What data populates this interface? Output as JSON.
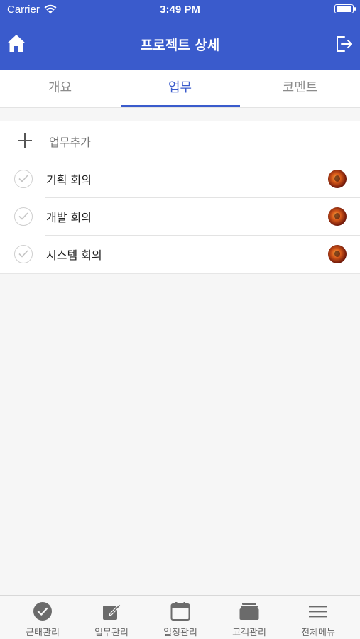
{
  "status_bar": {
    "carrier": "Carrier",
    "time": "3:49 PM",
    "battery_level": 1.0
  },
  "header": {
    "title": "프로젝트 상세",
    "left_icon": "home-icon",
    "right_icon": "logout-icon"
  },
  "tabs": [
    {
      "label": "개요",
      "active": false
    },
    {
      "label": "업무",
      "active": true
    },
    {
      "label": "코멘트",
      "active": false
    }
  ],
  "add_task": {
    "label": "업무추가",
    "icon": "plus-icon"
  },
  "tasks": [
    {
      "title": "기획 회의",
      "completed": false
    },
    {
      "title": "개발 회의",
      "completed": false
    },
    {
      "title": "시스템 회의",
      "completed": false
    }
  ],
  "tab_bar": [
    {
      "label": "근태관리",
      "icon": "check-circle-icon"
    },
    {
      "label": "업무관리",
      "icon": "edit-icon"
    },
    {
      "label": "일정관리",
      "icon": "calendar-icon"
    },
    {
      "label": "고객관리",
      "icon": "folder-stack-icon"
    },
    {
      "label": "전체메뉴",
      "icon": "menu-icon"
    }
  ],
  "colors": {
    "primary": "#3a5bcc",
    "background": "#f6f6f6",
    "tab_bar_icon": "#666666"
  }
}
